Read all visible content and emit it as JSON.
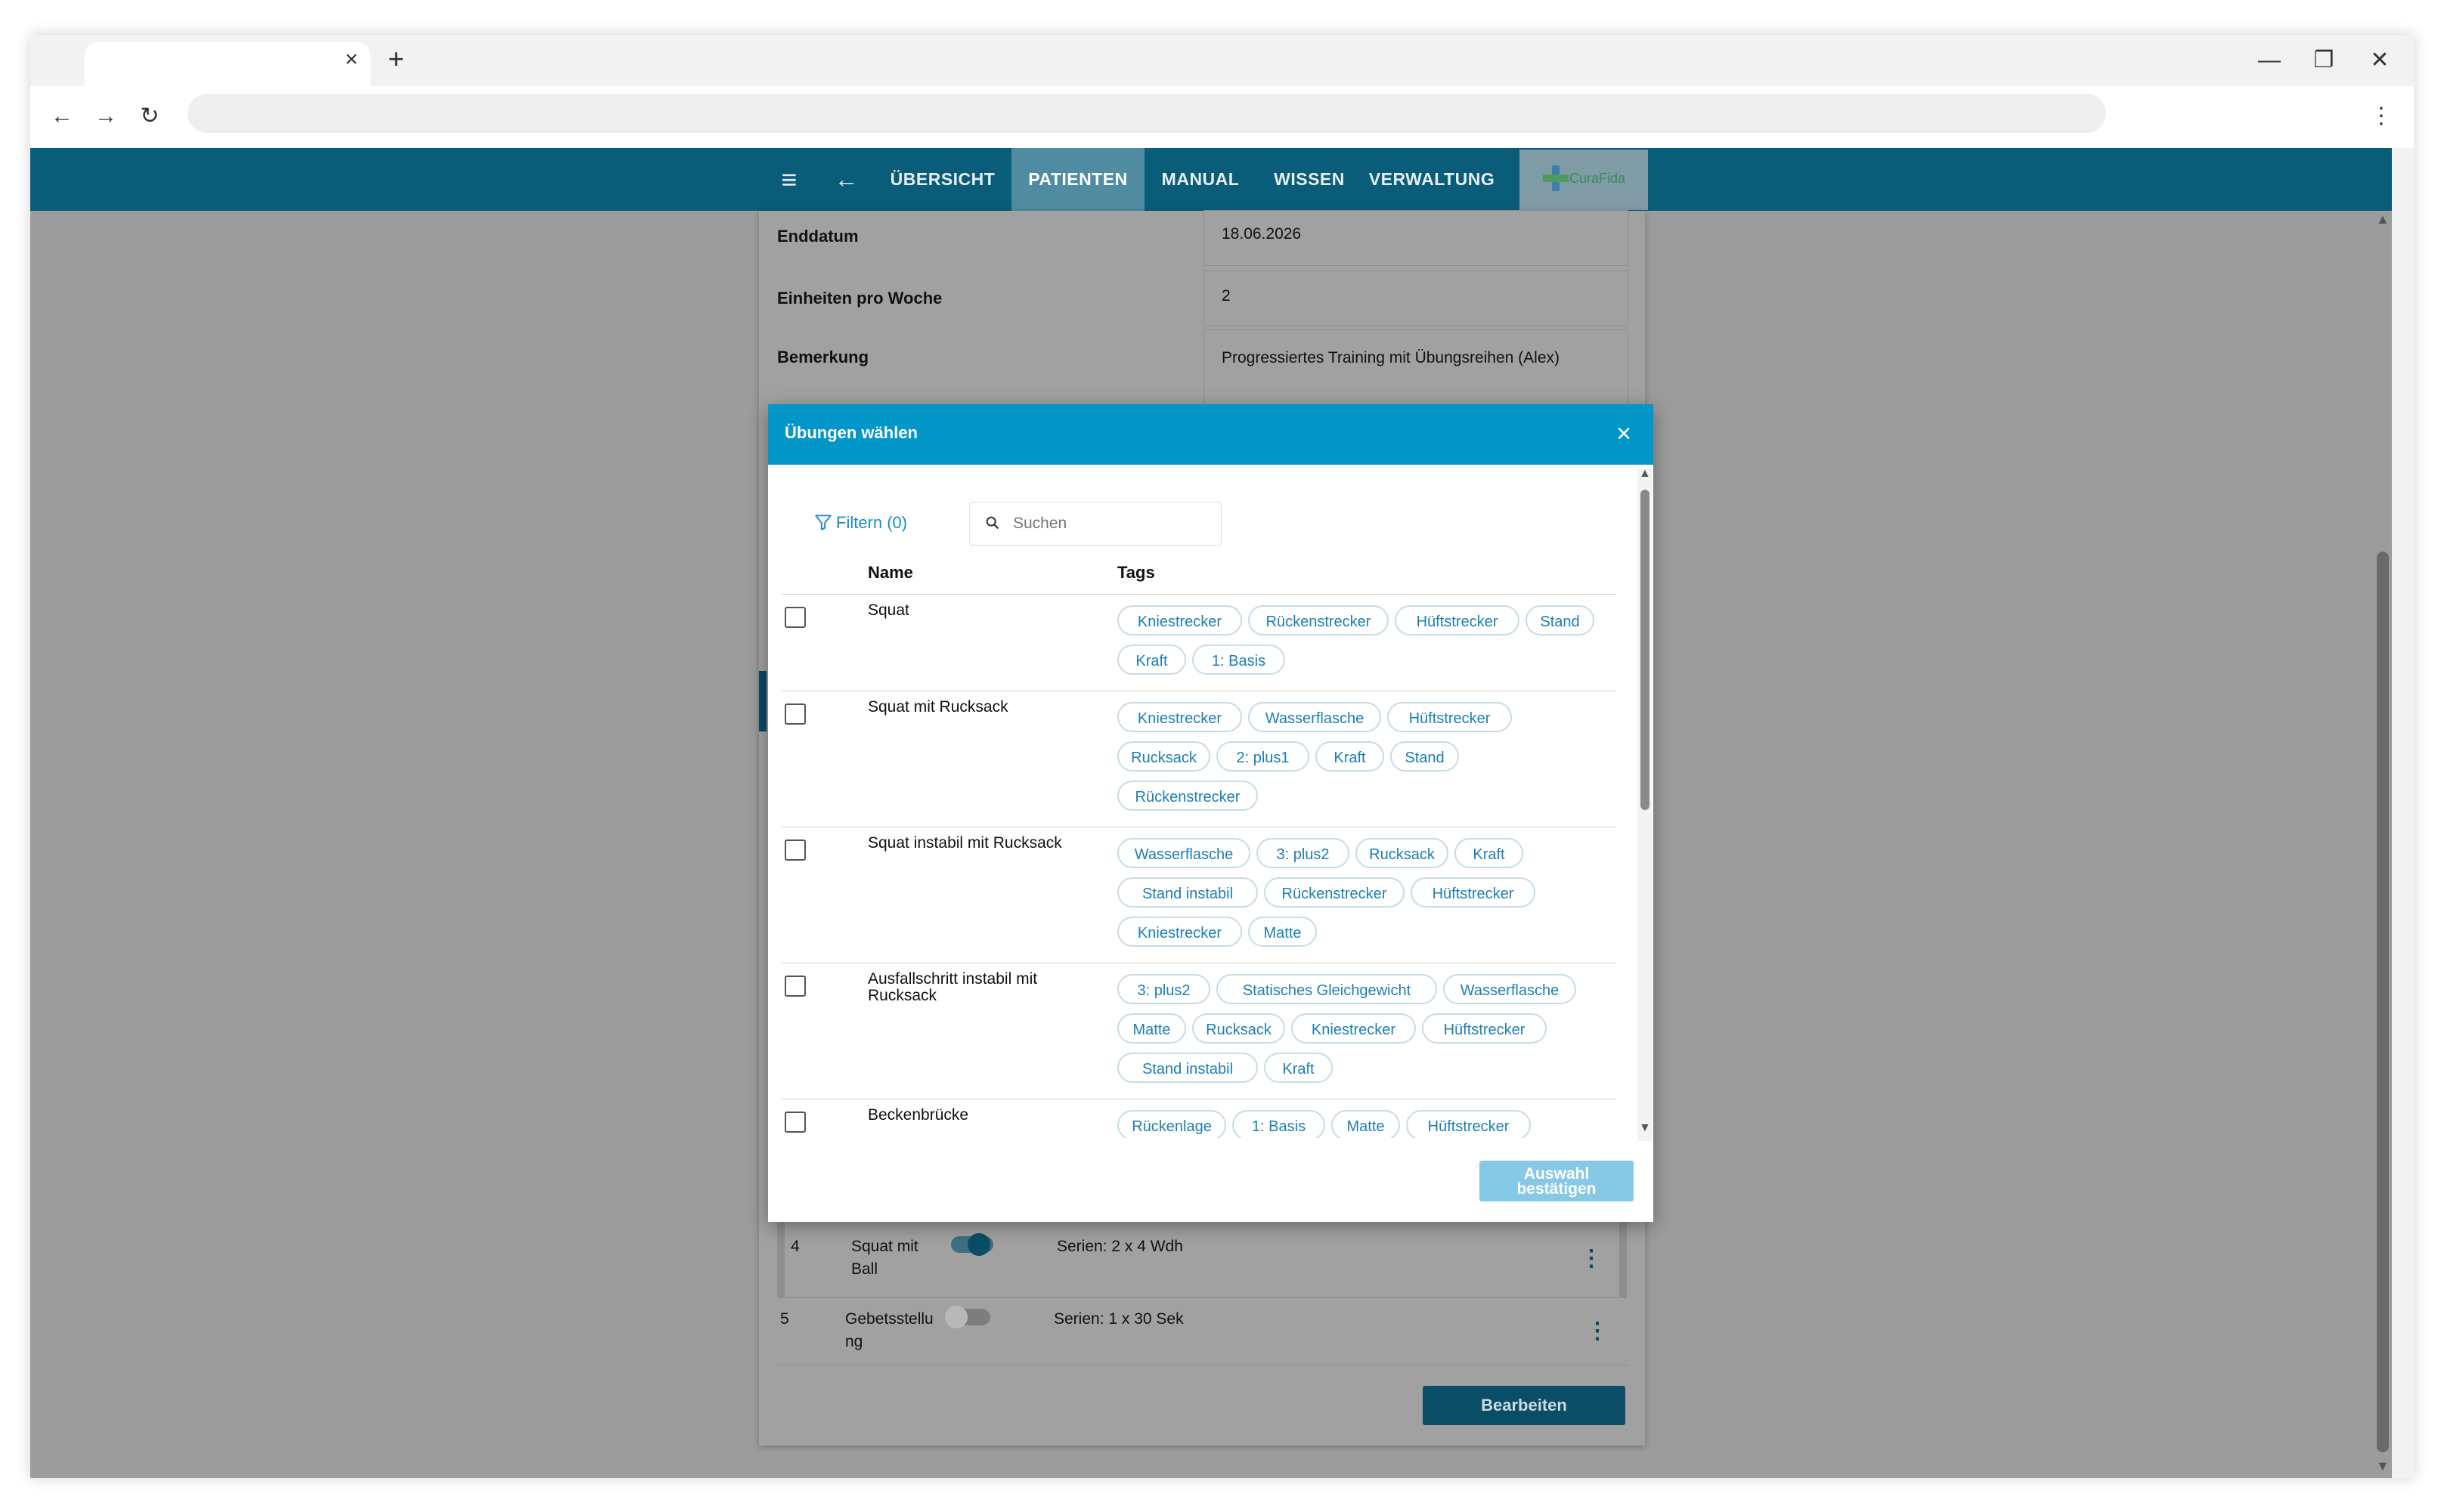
{
  "browser": {
    "tab_close_icon": "×",
    "new_tab_icon": "+",
    "minimize_icon": "—",
    "restore_icon": "❐",
    "close_icon": "✕",
    "back_icon": "←",
    "forward_icon": "→",
    "reload_icon": "↻",
    "menu_icon": "⋮"
  },
  "app_bar": {
    "menu_icon": "≡",
    "back_icon": "←",
    "nav": [
      "ÜBERSICHT",
      "PATIENTEN",
      "MANUAL",
      "WISSEN",
      "VERWALTUNG"
    ],
    "active_nav": "PATIENTEN",
    "logo_text": "CuraFida"
  },
  "form": {
    "enddatum_label": "Enddatum",
    "enddatum_value": "18.06.2026",
    "einheiten_label": "Einheiten pro Woche",
    "einheiten_value": "2",
    "bemerkung_label": "Bemerkung",
    "bemerkung_value": "Progressiertes Training mit Übungsreihen (Alex)"
  },
  "background_rows": [
    {
      "index": "4",
      "name_line1": "Squat mit",
      "name_line2": "Ball",
      "series": "Serien: 2 x 4 Wdh",
      "toggle_on": true
    },
    {
      "index": "5",
      "name_line1": "Gebetsstellu",
      "name_line2": "ng",
      "series": "Serien: 1 x 30 Sek",
      "toggle_on": false
    }
  ],
  "edit_button_label": "Bearbeiten",
  "modal": {
    "title": "Übungen wählen",
    "close_icon": "×",
    "filter_label": "Filtern (0)",
    "search_placeholder": "Suchen",
    "col_name": "Name",
    "col_tags": "Tags",
    "confirm_label_line1": "Auswahl",
    "confirm_label_line2": "bestätigen",
    "exercises": [
      {
        "name": "Squat",
        "checked": false,
        "tags": [
          [
            "Kniestrecker",
            "Rückenstrecker",
            "Hüftstrecker",
            "Stand"
          ],
          [
            "Kraft",
            "1: Basis"
          ]
        ]
      },
      {
        "name": "Squat mit Rucksack",
        "checked": false,
        "tags": [
          [
            "Kniestrecker",
            "Wasserflasche",
            "Hüftstrecker"
          ],
          [
            "Rucksack",
            "2: plus1",
            "Kraft",
            "Stand"
          ],
          [
            "Rückenstrecker"
          ]
        ]
      },
      {
        "name": "Squat instabil mit Rucksack",
        "checked": false,
        "tags": [
          [
            "Wasserflasche",
            "3: plus2",
            "Rucksack",
            "Kraft"
          ],
          [
            "Stand instabil",
            "Rückenstrecker",
            "Hüftstrecker"
          ],
          [
            "Kniestrecker",
            "Matte"
          ]
        ]
      },
      {
        "name": "Ausfallschritt instabil mit Rucksack",
        "checked": false,
        "tags": [
          [
            "3: plus2",
            "Statisches Gleichgewicht",
            "Wasserflasche"
          ],
          [
            "Matte",
            "Rucksack",
            "Kniestrecker",
            "Hüftstrecker"
          ],
          [
            "Stand instabil",
            "Kraft"
          ]
        ]
      },
      {
        "name": "Beckenbrücke",
        "checked": false,
        "tags": [
          [
            "Rückenlage",
            "1: Basis",
            "Matte",
            "Hüftstrecker"
          ]
        ]
      }
    ]
  }
}
